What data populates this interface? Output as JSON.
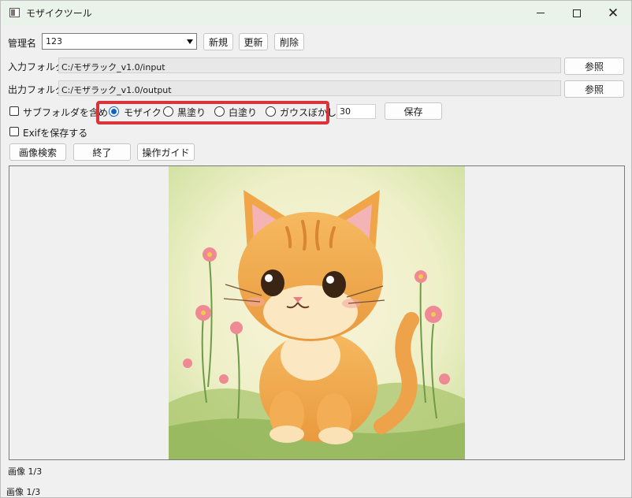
{
  "window": {
    "title": "モザイクツール"
  },
  "management": {
    "label": "管理名",
    "value": "123",
    "new_label": "新規",
    "update_label": "更新",
    "delete_label": "削除"
  },
  "input_folder": {
    "label": "入力フォルダ",
    "path": "C:/モザラック_v1.0/input",
    "browse_label": "参照"
  },
  "output_folder": {
    "label": "出力フォルダ",
    "path": "C:/モザラック_v1.0/output",
    "browse_label": "参照"
  },
  "options": {
    "include_subfolders_label": "サブフォルダを含める",
    "include_subfolders_checked": false,
    "save_exif_label": "Exifを保存する",
    "save_exif_checked": false,
    "mode_options": [
      "モザイク",
      "黒塗り",
      "白塗り",
      "ガウスぼかし"
    ],
    "selected_mode": "モザイク",
    "strength_value": "30",
    "save_label": "保存"
  },
  "actions": {
    "search_label": "画像検索",
    "exit_label": "終了",
    "guide_label": "操作ガイド"
  },
  "viewer": {
    "image_subject": "cat-illustration"
  },
  "status": {
    "image_counter": "画像 1/3",
    "statusbar_text": "画像 1/3"
  },
  "colors": {
    "highlight_border": "#d9343b",
    "radio_selected": "#1463c4",
    "titlebar": "#eaf3ea"
  }
}
